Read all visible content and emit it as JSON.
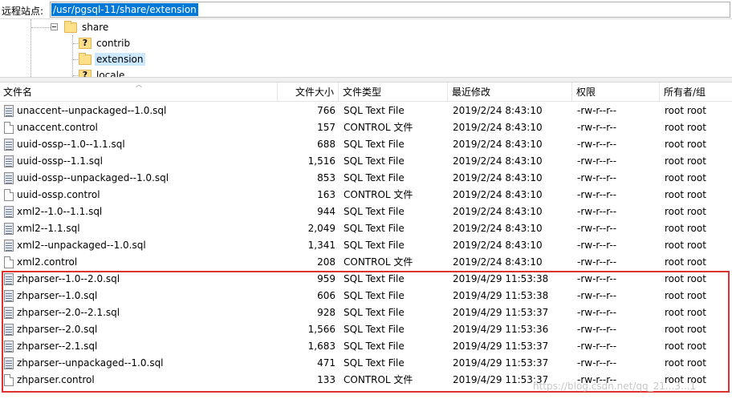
{
  "path_bar": {
    "label": "远程站点:",
    "path": "/usr/pgsql-11/share/extension"
  },
  "tree": {
    "parent": "share",
    "children": [
      "contrib",
      "extension",
      "locale"
    ],
    "selected": "extension"
  },
  "columns": {
    "name": "文件名",
    "size": "文件大小",
    "type": "文件类型",
    "modified": "最近修改",
    "perms": "权限",
    "owner": "所有者/组"
  },
  "files": [
    {
      "name": "unaccent--unpackaged--1.0.sql",
      "size": "766",
      "type": "SQL Text File",
      "modified": "2019/2/24 8:43:10",
      "perms": "-rw-r--r--",
      "owner": "root root",
      "icon": "sql-file-icon"
    },
    {
      "name": "unaccent.control",
      "size": "157",
      "type": "CONTROL 文件",
      "modified": "2019/2/24 8:43:10",
      "perms": "-rw-r--r--",
      "owner": "root root",
      "icon": "control-file-icon"
    },
    {
      "name": "uuid-ossp--1.0--1.1.sql",
      "size": "688",
      "type": "SQL Text File",
      "modified": "2019/2/24 8:43:10",
      "perms": "-rw-r--r--",
      "owner": "root root",
      "icon": "sql-file-icon"
    },
    {
      "name": "uuid-ossp--1.1.sql",
      "size": "1,516",
      "type": "SQL Text File",
      "modified": "2019/2/24 8:43:10",
      "perms": "-rw-r--r--",
      "owner": "root root",
      "icon": "sql-file-icon"
    },
    {
      "name": "uuid-ossp--unpackaged--1.0.sql",
      "size": "853",
      "type": "SQL Text File",
      "modified": "2019/2/24 8:43:10",
      "perms": "-rw-r--r--",
      "owner": "root root",
      "icon": "sql-file-icon"
    },
    {
      "name": "uuid-ossp.control",
      "size": "163",
      "type": "CONTROL 文件",
      "modified": "2019/2/24 8:43:10",
      "perms": "-rw-r--r--",
      "owner": "root root",
      "icon": "control-file-icon"
    },
    {
      "name": "xml2--1.0--1.1.sql",
      "size": "944",
      "type": "SQL Text File",
      "modified": "2019/2/24 8:43:10",
      "perms": "-rw-r--r--",
      "owner": "root root",
      "icon": "sql-file-icon"
    },
    {
      "name": "xml2--1.1.sql",
      "size": "2,049",
      "type": "SQL Text File",
      "modified": "2019/2/24 8:43:10",
      "perms": "-rw-r--r--",
      "owner": "root root",
      "icon": "sql-file-icon"
    },
    {
      "name": "xml2--unpackaged--1.0.sql",
      "size": "1,341",
      "type": "SQL Text File",
      "modified": "2019/2/24 8:43:10",
      "perms": "-rw-r--r--",
      "owner": "root root",
      "icon": "sql-file-icon"
    },
    {
      "name": "xml2.control",
      "size": "208",
      "type": "CONTROL 文件",
      "modified": "2019/2/24 8:43:10",
      "perms": "-rw-r--r--",
      "owner": "root root",
      "icon": "control-file-icon"
    },
    {
      "name": "zhparser--1.0--2.0.sql",
      "size": "959",
      "type": "SQL Text File",
      "modified": "2019/4/29 11:53:38",
      "perms": "-rw-r--r--",
      "owner": "root root",
      "icon": "sql-file-icon"
    },
    {
      "name": "zhparser--1.0.sql",
      "size": "606",
      "type": "SQL Text File",
      "modified": "2019/4/29 11:53:38",
      "perms": "-rw-r--r--",
      "owner": "root root",
      "icon": "sql-file-icon"
    },
    {
      "name": "zhparser--2.0--2.1.sql",
      "size": "928",
      "type": "SQL Text File",
      "modified": "2019/4/29 11:53:37",
      "perms": "-rw-r--r--",
      "owner": "root root",
      "icon": "sql-file-icon"
    },
    {
      "name": "zhparser--2.0.sql",
      "size": "1,566",
      "type": "SQL Text File",
      "modified": "2019/4/29 11:53:36",
      "perms": "-rw-r--r--",
      "owner": "root root",
      "icon": "sql-file-icon"
    },
    {
      "name": "zhparser--2.1.sql",
      "size": "1,683",
      "type": "SQL Text File",
      "modified": "2019/4/29 11:53:37",
      "perms": "-rw-r--r--",
      "owner": "root root",
      "icon": "sql-file-icon"
    },
    {
      "name": "zhparser--unpackaged--1.0.sql",
      "size": "471",
      "type": "SQL Text File",
      "modified": "2019/4/29 11:53:37",
      "perms": "-rw-r--r--",
      "owner": "root root",
      "icon": "sql-file-icon"
    },
    {
      "name": "zhparser.control",
      "size": "133",
      "type": "CONTROL 文件",
      "modified": "2019/4/29 11:53:37",
      "perms": "-rw-r--r--",
      "owner": "root root",
      "icon": "control-file-icon"
    }
  ],
  "watermark": "https://blog.csdn.net/qq_21...3...1",
  "colors": {
    "selection": "#0078d7",
    "tree_selection": "#cce8ff",
    "annotation": "#e0312f"
  }
}
